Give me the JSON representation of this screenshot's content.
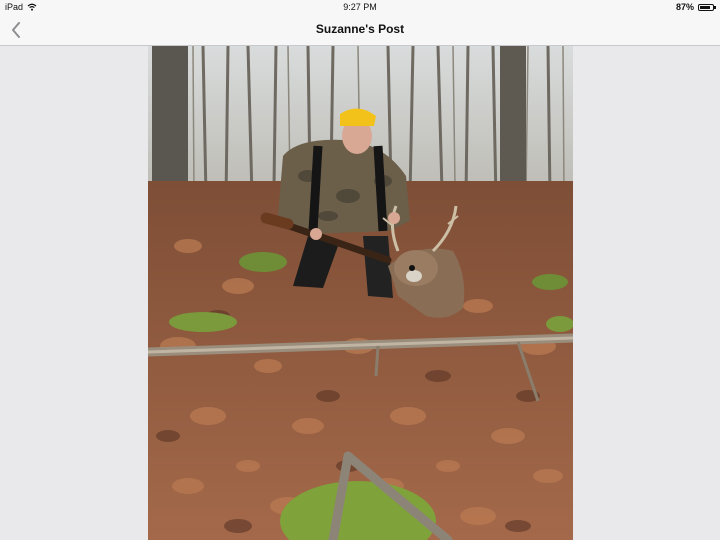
{
  "status_bar": {
    "device": "iPad",
    "time": "9:27 PM",
    "battery": "87%",
    "battery_level": 0.87,
    "wifi_icon": "wifi-icon",
    "battery_icon": "battery-icon"
  },
  "nav": {
    "title": "Suzanne's Post",
    "back_icon": "chevron-left-icon"
  },
  "colors": {
    "accent": "#8e8e93",
    "bar_background": "#f7f7f8",
    "page_background": "#e9e9ec",
    "hat": "#f2c21a"
  }
}
